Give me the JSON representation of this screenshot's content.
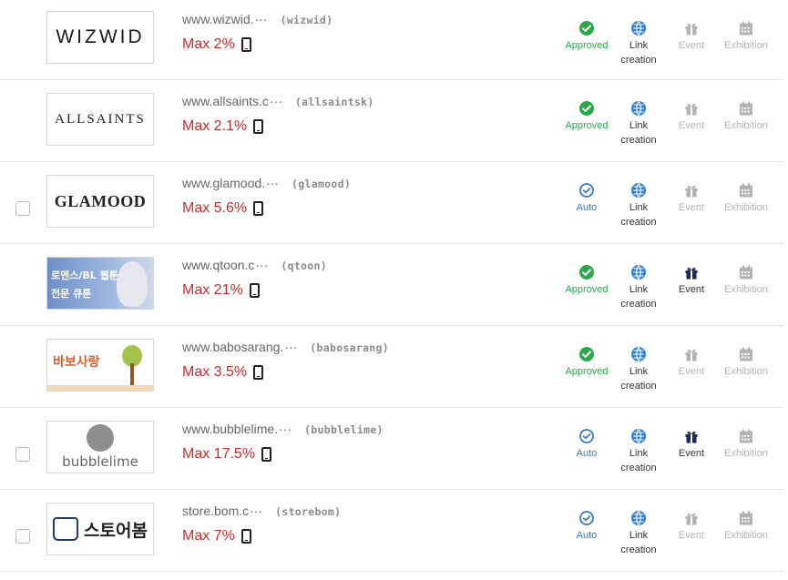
{
  "colors": {
    "approved": "#2aa84a",
    "auto": "#3a7bc8",
    "max_red": "#cc2b2b",
    "disabled": "#b3b3b3",
    "link_blue": "#2f7fd0",
    "event_navy": "#1b2a5a"
  },
  "labels": {
    "link": "Link creation",
    "event": "Event",
    "exhibition": "Exhibition",
    "approved": "Approved",
    "auto": "Auto"
  },
  "rows": [
    {
      "checkbox": false,
      "logo_text": "WIZWID",
      "url": "www.wizwid.",
      "handle": "(wizwid)",
      "max": "Max 2%",
      "status": "Approved",
      "status_type": "approved",
      "event_active": false
    },
    {
      "checkbox": false,
      "logo_text": "ALLSAINTS",
      "url": "www.allsaints.c",
      "handle": "(allsaintsk)",
      "max": "Max 2.1%",
      "status": "Approved",
      "status_type": "approved",
      "event_active": false
    },
    {
      "checkbox": true,
      "logo_text": "GLAMOOD",
      "url": "www.glamood.",
      "handle": "(glamood)",
      "max": "Max 5.6%",
      "status": "Auto",
      "status_type": "auto",
      "event_active": false
    },
    {
      "checkbox": false,
      "logo_text": "로맨스/BL 웹툰 전문 큐툰",
      "url": "www.qtoon.c",
      "handle": "(qtoon)",
      "max": "Max 21%",
      "status": "Approved",
      "status_type": "approved",
      "event_active": true
    },
    {
      "checkbox": false,
      "logo_text": "바보사랑",
      "url": "www.babosarang.",
      "handle": "(babosarang)",
      "max": "Max 3.5%",
      "status": "Approved",
      "status_type": "approved",
      "event_active": false
    },
    {
      "checkbox": true,
      "logo_text": "bubblelime",
      "url": "www.bubblelime.",
      "handle": "(bubblelime)",
      "max": "Max 17.5%",
      "status": "Auto",
      "status_type": "auto",
      "event_active": true
    },
    {
      "checkbox": true,
      "logo_text": "스토어봄",
      "url": "store.bom.c",
      "handle": "(storebom)",
      "max": "Max 7%",
      "status": "Auto",
      "status_type": "auto",
      "event_active": false
    }
  ]
}
